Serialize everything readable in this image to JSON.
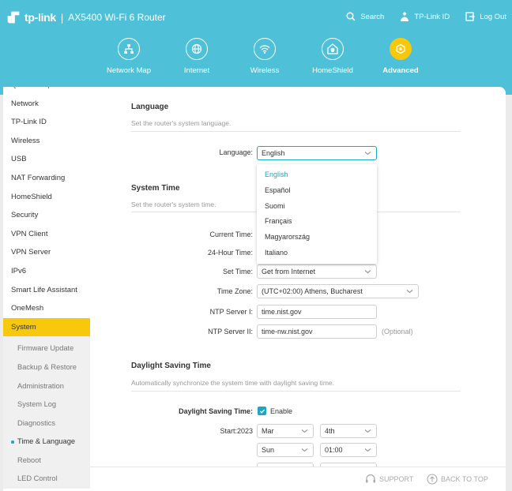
{
  "header": {
    "brand_name": "tp-link",
    "separator": "|",
    "model": "AX5400 Wi-Fi 6 Router",
    "links": [
      {
        "label": "Search",
        "icon": "search-icon"
      },
      {
        "label": "TP-Link ID",
        "icon": "user-icon"
      },
      {
        "label": "Log Out",
        "icon": "logout-icon"
      }
    ],
    "nav": [
      {
        "label": "Network Map",
        "icon": "network-map-icon"
      },
      {
        "label": "Internet",
        "icon": "globe-icon"
      },
      {
        "label": "Wireless",
        "icon": "wifi-icon"
      },
      {
        "label": "HomeShield",
        "icon": "homeshield-icon"
      },
      {
        "label": "Advanced",
        "icon": "gear-icon",
        "active": true
      }
    ],
    "accent_color": "#4ec1d9",
    "active_color": "#f7c80b"
  },
  "sidebar": {
    "clipped_item": "Quick Setup",
    "items": [
      "Network",
      "TP-Link ID",
      "Wireless",
      "USB",
      "NAT Forwarding",
      "HomeShield",
      "Security",
      "VPN Client",
      "VPN Server",
      "IPv6",
      "Smart Life Assistant",
      "OneMesh",
      "System"
    ],
    "sub_items": [
      "Firmware Update",
      "Backup & Restore",
      "Administration",
      "System Log",
      "Diagnostics",
      "Time & Language",
      "Reboot",
      "LED Control"
    ],
    "active_item": "System",
    "current_sub_item": "Time & Language"
  },
  "language": {
    "title": "Language",
    "desc": "Set the router's system language.",
    "label": "Language:",
    "value": "English",
    "options": [
      "English",
      "Español",
      "Suomi",
      "Français",
      "Magyarország",
      "Italiano"
    ]
  },
  "system_time": {
    "title": "System Time",
    "desc": "Set the router's system time.",
    "current_time_label": "Current Time:",
    "hour24_label": "24-Hour Time:",
    "set_time_label": "Set Time:",
    "set_time_value": "Get from Internet",
    "time_zone_label": "Time Zone:",
    "time_zone_value": "(UTC+02:00) Athens, Bucharest",
    "ntp1_label": "NTP Server I:",
    "ntp1_value": "time.nist.gov",
    "ntp2_label": "NTP Server II:",
    "ntp2_value": "time-nw.nist.gov",
    "optional": "(Optional)"
  },
  "dst": {
    "title": "Daylight Saving Time",
    "desc": "Automatically synchronize the system time with daylight saving time.",
    "label": "Daylight Saving Time:",
    "enable_label": "Enable",
    "enabled": true,
    "start_label": "Start:2023",
    "start_month": "Mar",
    "start_week": "4th",
    "start_day": "Sun",
    "start_time": "01:00"
  },
  "footer": {
    "support": "SUPPORT",
    "back_to_top": "BACK TO TOP"
  }
}
